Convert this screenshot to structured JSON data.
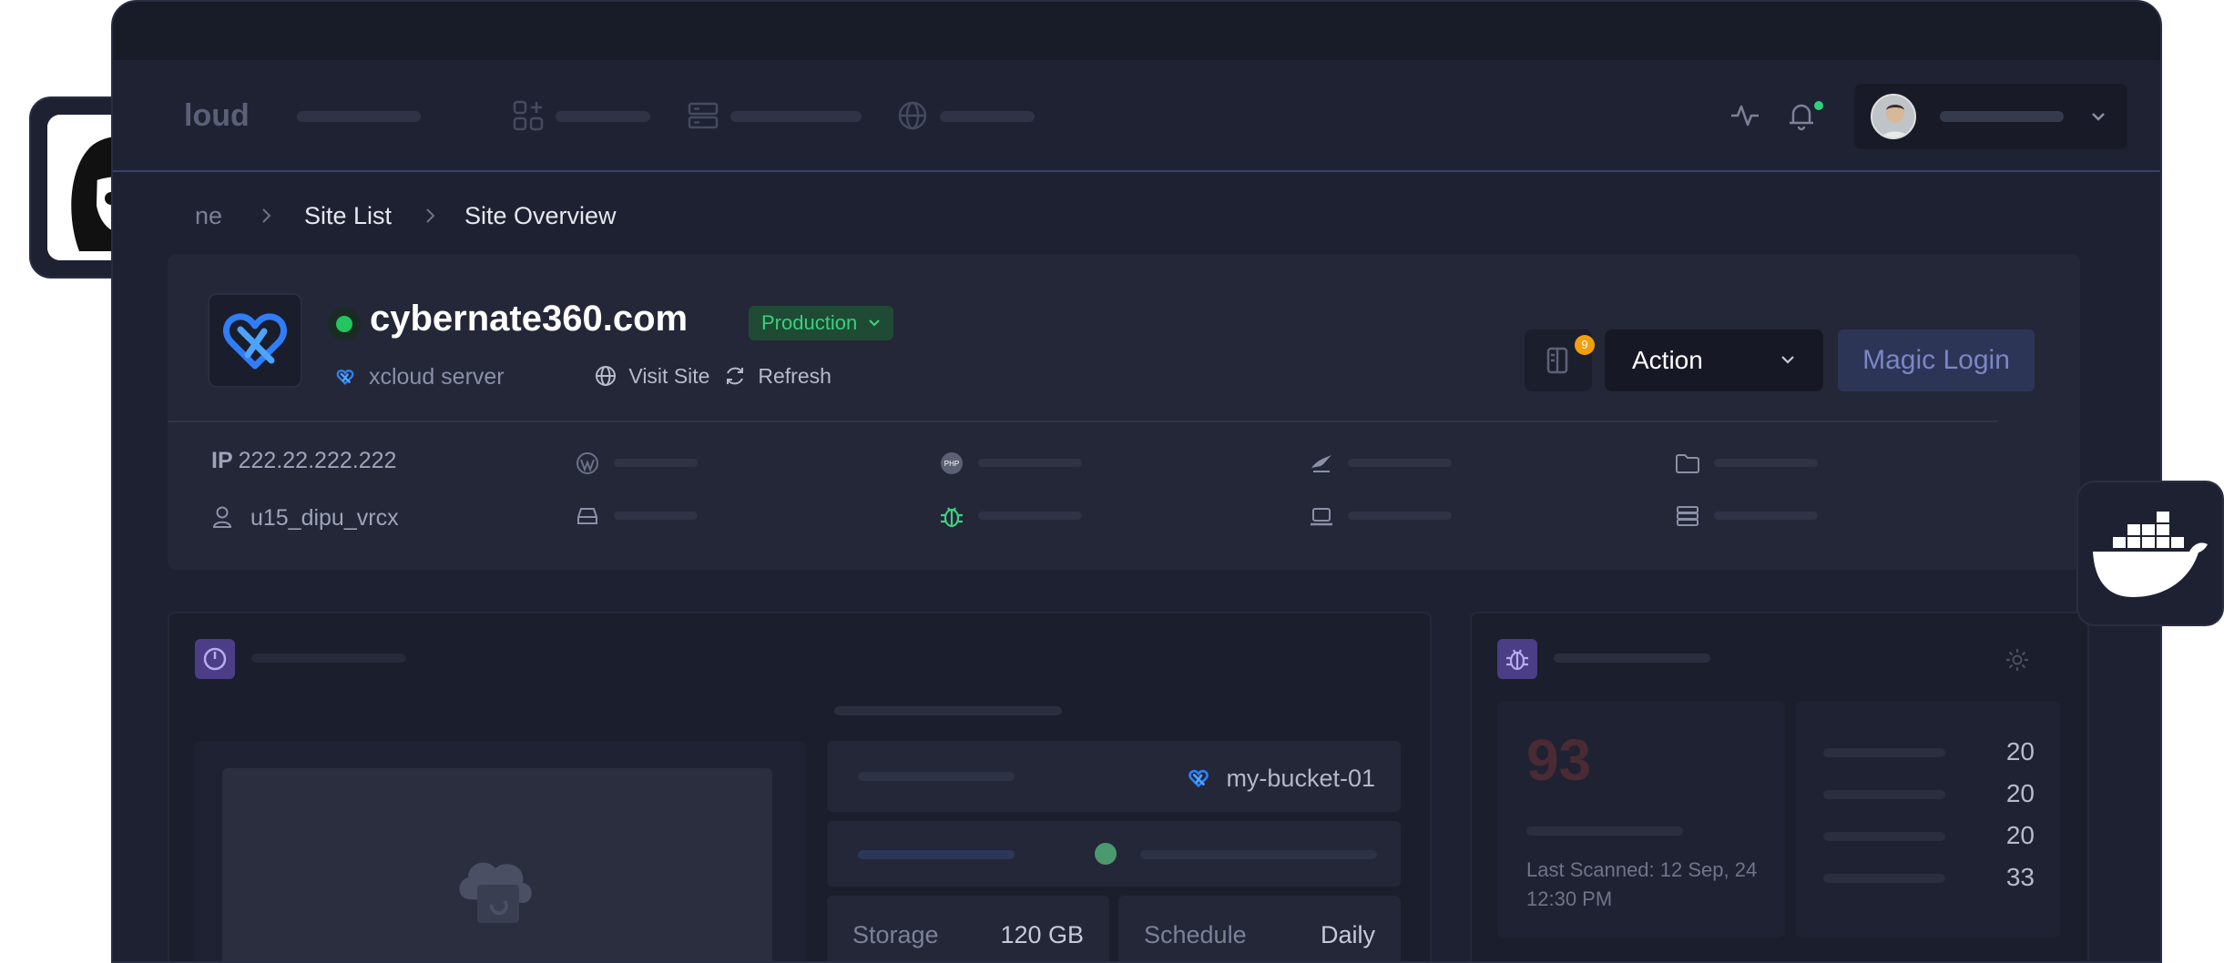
{
  "header": {
    "logo_text": "loud"
  },
  "breadcrumb": {
    "home": "ne",
    "site_list": "Site List",
    "current": "Site Overview"
  },
  "site": {
    "name": "cybernate360.com",
    "environment": "Production",
    "server": "xcloud server",
    "visit_label": "Visit Site",
    "refresh_label": "Refresh",
    "notes_count": "9",
    "action_label": "Action",
    "magic_login_label": "Magic Login",
    "ip_label": "IP",
    "ip": "222.22.222.222",
    "user": "u15_dipu_vrcx"
  },
  "backup": {
    "bucket": "my-bucket-01",
    "storage_label": "Storage",
    "storage_value": "120 GB",
    "schedule_label": "Schedule",
    "schedule_value": "Daily"
  },
  "security": {
    "score": "93",
    "last_scanned": "Last Scanned: 12 Sep, 24 12:30 PM",
    "counts": [
      "20",
      "20",
      "20",
      "33"
    ]
  },
  "colors": {
    "background": "#1e2131",
    "accent_green": "#22c55e",
    "accent_purple": "#4b3e86",
    "magic_button": "#2d3556"
  },
  "icons": [
    "grid-plus-icon",
    "server-list-icon",
    "globe-icon",
    "activity-icon",
    "bell-icon",
    "chevron-down-icon",
    "notes-icon",
    "wordpress-icon",
    "php-icon",
    "database-icon",
    "folder-icon",
    "user-icon",
    "drive-icon",
    "bug-icon",
    "laptop-icon",
    "storage-icon",
    "settings-icon",
    "docker-icon"
  ]
}
